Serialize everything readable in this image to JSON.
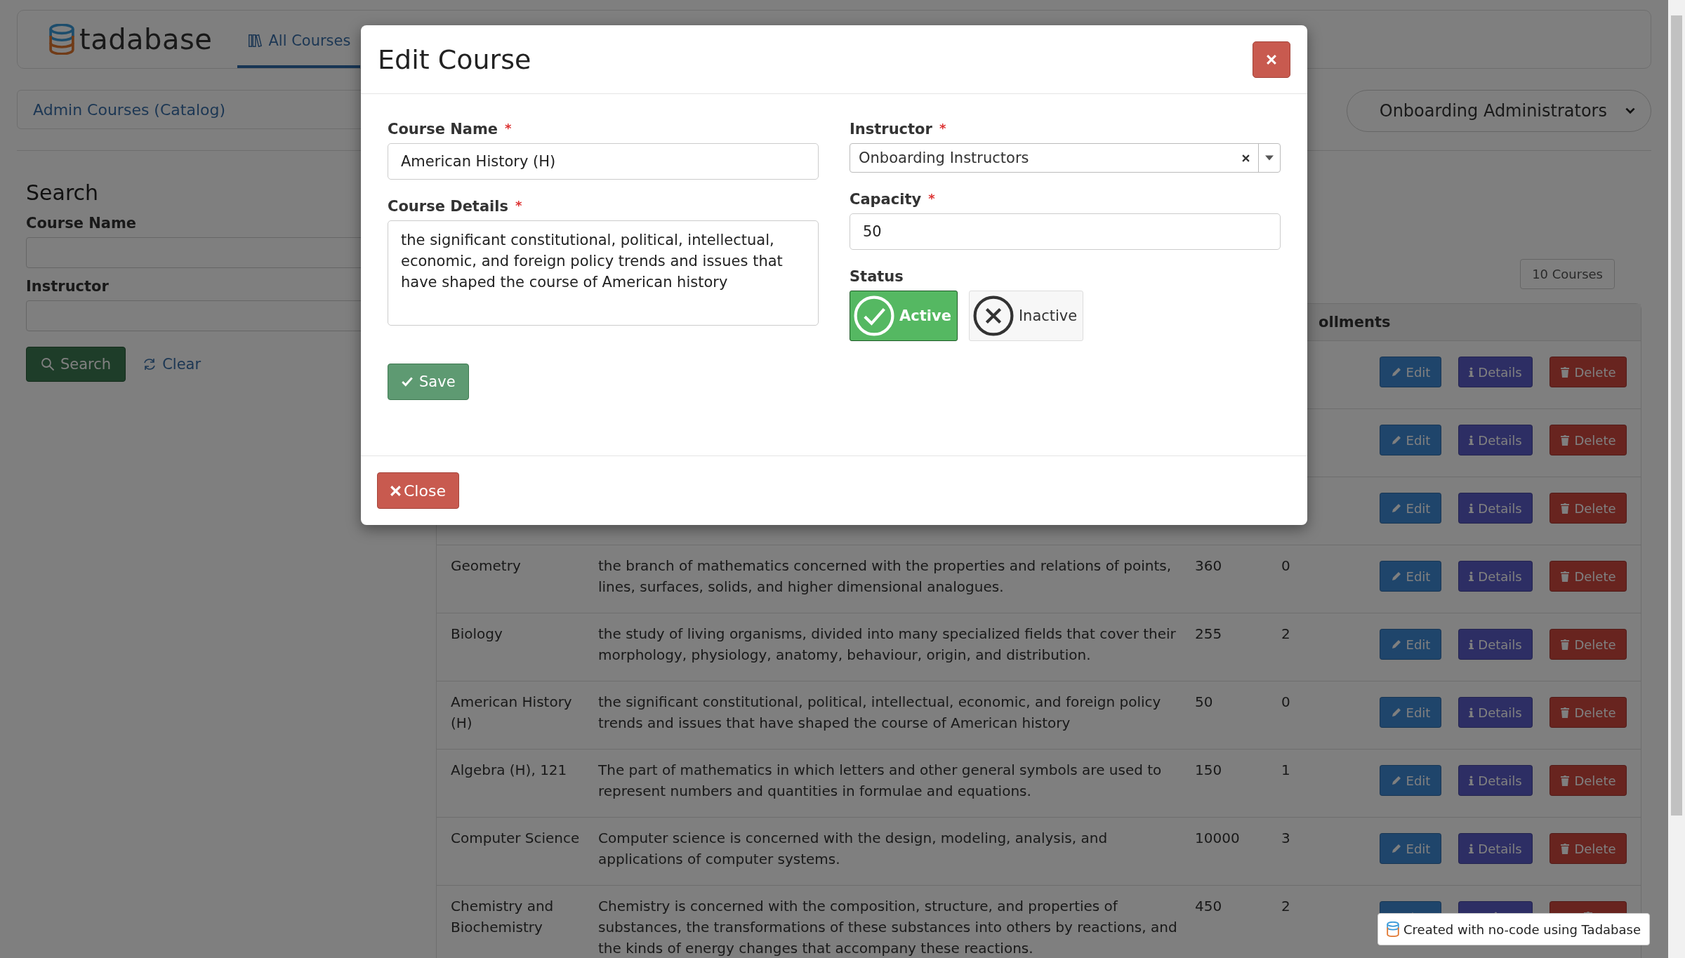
{
  "header": {
    "logo": "tadabase",
    "tabs": [
      {
        "label": "All Courses",
        "selected": true
      }
    ]
  },
  "breadcrumb": "Admin Courses (Catalog)",
  "user_menu": "Onboarding Administrators",
  "search": {
    "title": "Search",
    "fields": [
      {
        "label": "Course Name"
      },
      {
        "label": "Instructor"
      }
    ],
    "search_button": "Search",
    "clear_button": "Clear"
  },
  "table": {
    "count": "10 Courses",
    "visible_header": "ollments",
    "rows": [
      {
        "actions": [
          {
            "kind": "edit",
            "label": "Edit"
          },
          {
            "kind": "details",
            "label": "Details"
          },
          {
            "kind": "delete",
            "label": "Delete"
          }
        ]
      },
      {
        "actions": [
          {
            "kind": "edit",
            "label": "Edit"
          },
          {
            "kind": "details",
            "label": "Details"
          },
          {
            "kind": "delete",
            "label": "Delete"
          }
        ]
      },
      {
        "actions": [
          {
            "kind": "edit",
            "label": "Edit"
          },
          {
            "kind": "details",
            "label": "Details"
          },
          {
            "kind": "delete",
            "label": "Delete"
          }
        ]
      },
      {
        "name": "Geometry",
        "details": "the branch of mathematics concerned with the properties and relations of points, lines, surfaces, solids, and higher dimensional analogues.",
        "capacity": "360",
        "enrollments": "0",
        "actions": [
          {
            "kind": "edit",
            "label": "Edit"
          },
          {
            "kind": "details",
            "label": "Details"
          },
          {
            "kind": "delete",
            "label": "Delete"
          }
        ]
      },
      {
        "name": "Biology",
        "details": "the study of living organisms, divided into many specialized fields that cover their morphology, physiology, anatomy, behaviour, origin, and distribution.",
        "capacity": "255",
        "enrollments": "2",
        "actions": [
          {
            "kind": "edit",
            "label": "Edit"
          },
          {
            "kind": "details",
            "label": "Details"
          },
          {
            "kind": "delete",
            "label": "Delete"
          }
        ]
      },
      {
        "name": "American History (H)",
        "details": "the significant constitutional, political, intellectual, economic, and foreign policy trends and issues that have shaped the course of American history",
        "capacity": "50",
        "enrollments": "0",
        "actions": [
          {
            "kind": "edit",
            "label": "Edit"
          },
          {
            "kind": "details",
            "label": "Details"
          },
          {
            "kind": "delete",
            "label": "Delete"
          }
        ]
      },
      {
        "name": "Algebra (H), 121",
        "details": "The part of mathematics in which letters and other general symbols are used to represent numbers and quantities in formulae and equations.",
        "capacity": "150",
        "enrollments": "1",
        "actions": [
          {
            "kind": "edit",
            "label": "Edit"
          },
          {
            "kind": "details",
            "label": "Details"
          },
          {
            "kind": "delete",
            "label": "Delete"
          }
        ]
      },
      {
        "name": "Computer Science",
        "details": "Computer science is concerned with the design, modeling, analysis, and applications of computer systems.",
        "capacity": "10000",
        "enrollments": "3",
        "actions": [
          {
            "kind": "edit",
            "label": "Edit"
          },
          {
            "kind": "details",
            "label": "Details"
          },
          {
            "kind": "delete",
            "label": "Delete"
          }
        ]
      },
      {
        "name": "Chemistry and Biochemistry",
        "details": "Chemistry is concerned with the composition, structure, and properties of substances, the transformations of these substances into others by reactions, and the kinds of energy changes that accompany these reactions.",
        "capacity": "450",
        "enrollments": "2",
        "actions": [
          {
            "kind": "edit"
          },
          {
            "kind": "details"
          },
          {
            "kind": "delete"
          }
        ]
      }
    ]
  },
  "modal": {
    "title": "Edit Course",
    "course_name": {
      "label": "Course Name",
      "required_mark": "*",
      "value": "American History (H)"
    },
    "course_details": {
      "label": "Course Details",
      "required_mark": "*",
      "value": "the significant constitutional, political, intellectual, economic, and foreign policy trends and issues that have shaped the course of American history"
    },
    "instructor": {
      "label": "Instructor",
      "required_mark": "*",
      "value": "Onboarding Instructors"
    },
    "capacity": {
      "label": "Capacity",
      "required_mark": "*",
      "value": "50"
    },
    "status": {
      "label": "Status",
      "options": [
        {
          "label": "Active",
          "kind": "active",
          "selected": true
        },
        {
          "label": "Inactive",
          "kind": "inactive",
          "selected": false
        }
      ]
    },
    "save_button": "Save",
    "close_button": "Close"
  },
  "badge": "Created with no-code using Tadabase"
}
